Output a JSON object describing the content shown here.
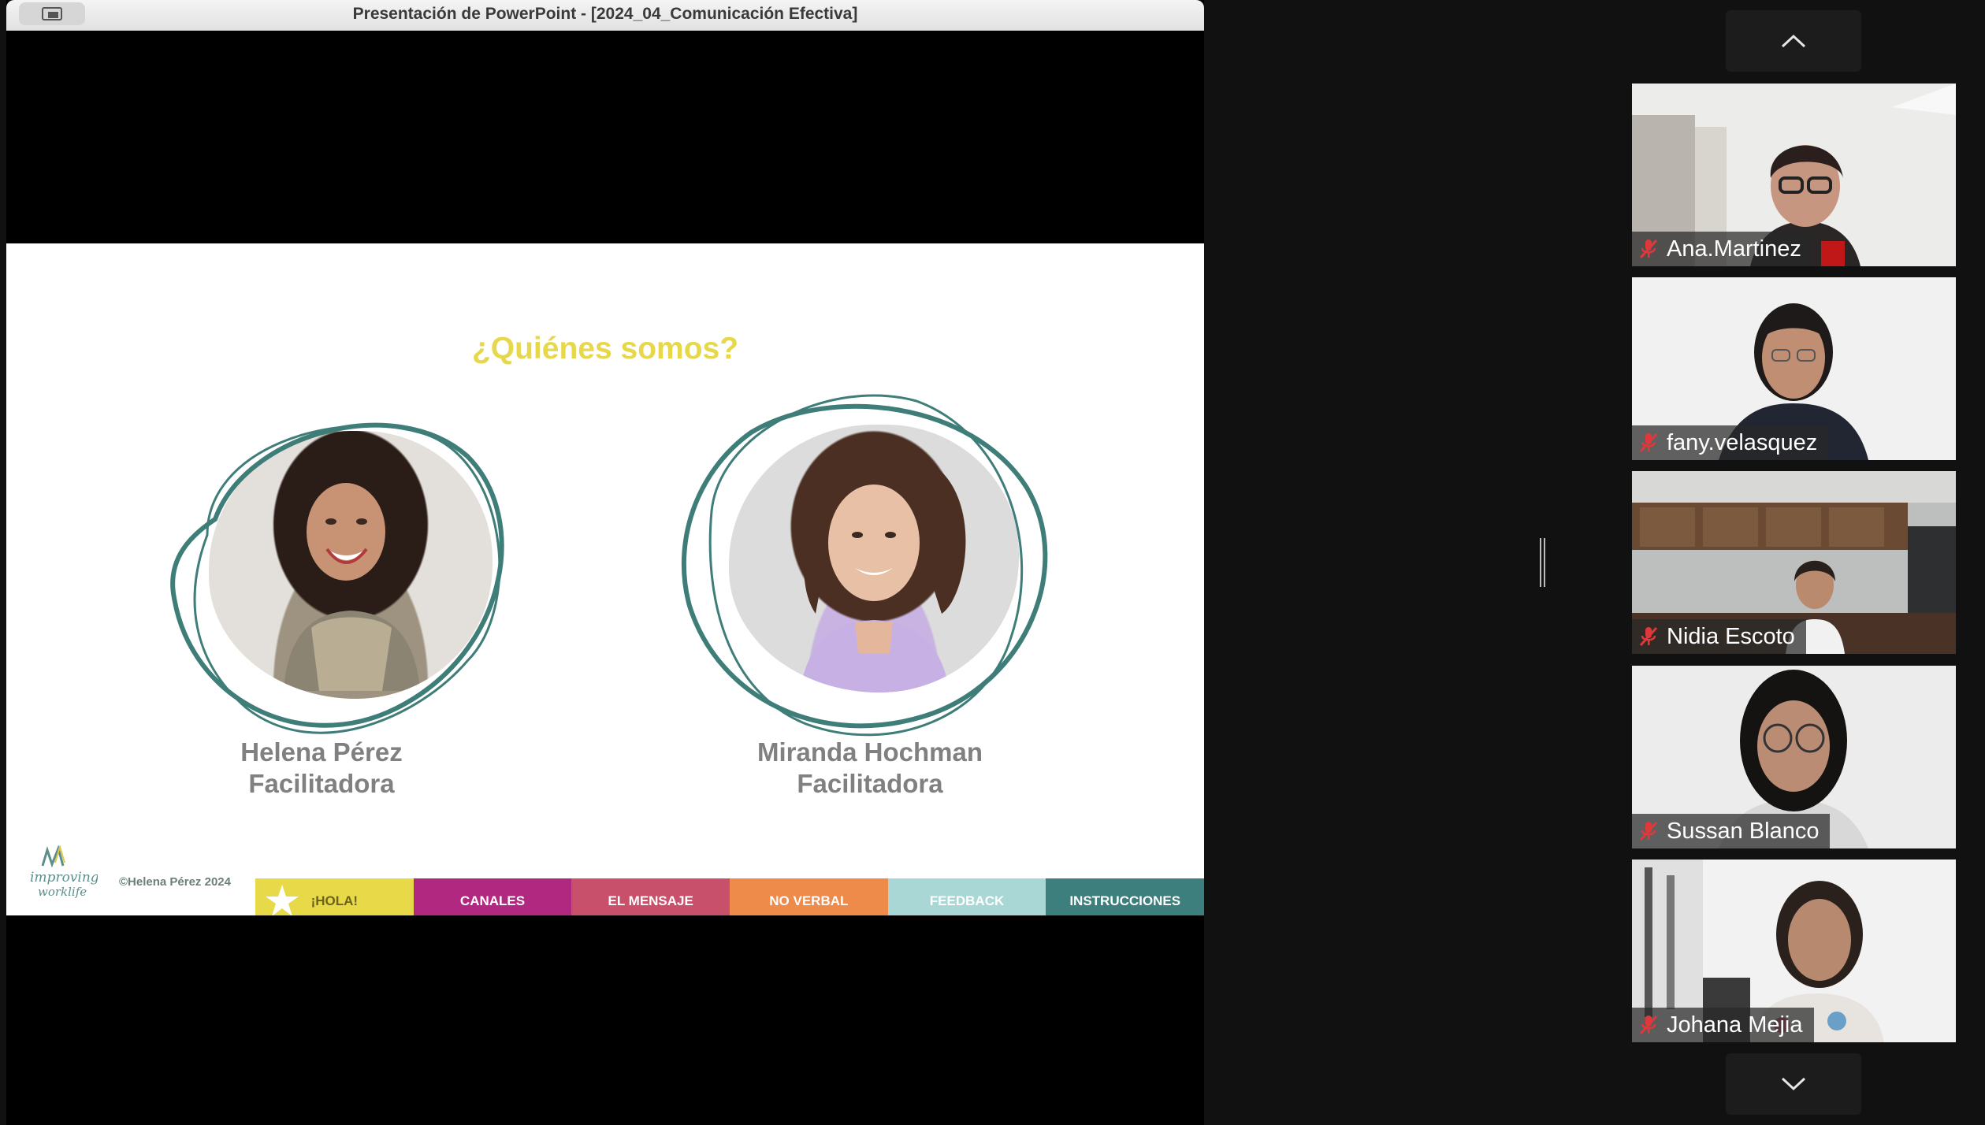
{
  "window": {
    "title": "Presentación de PowerPoint - [2024_04_Comunicación Efectiva]"
  },
  "slide": {
    "title": "¿Quiénes somos?",
    "people": [
      {
        "name": "Helena Pérez",
        "role": "Facilitadora"
      },
      {
        "name": "Miranda Hochman",
        "role": "Facilitadora"
      }
    ],
    "logo_text": [
      "improving",
      "worklife"
    ],
    "copyright": "©Helena Pérez 2024",
    "nav": [
      {
        "label": "¡HOLA!",
        "color": "#e8d948",
        "text_color": "#6b6220"
      },
      {
        "label": "CANALES",
        "color": "#b0287f",
        "text_color": "#ffffff"
      },
      {
        "label": "EL MENSAJE",
        "color": "#c9506a",
        "text_color": "#ffffff"
      },
      {
        "label": "NO VERBAL",
        "color": "#ee8a4a",
        "text_color": "#ffffff"
      },
      {
        "label": "FEEDBACK",
        "color": "#a9d7d5",
        "text_color": "#ffffff"
      },
      {
        "label": "INSTRUCCIONES",
        "color": "#3d7f7c",
        "text_color": "#ffffff"
      }
    ],
    "ring_color": "#3f7d79"
  },
  "participants": [
    {
      "name": "Ana.Martinez",
      "muted": true
    },
    {
      "name": "fany.velasquez",
      "muted": true
    },
    {
      "name": "Nidia Escoto",
      "muted": true
    },
    {
      "name": "Sussan Blanco",
      "muted": true
    },
    {
      "name": "Johana Mejia",
      "muted": true
    }
  ],
  "icons": {
    "scroll_up": "chevron-up-icon",
    "scroll_down": "chevron-down-icon",
    "mute": "mic-muted-icon",
    "share": "screen-share-icon"
  }
}
